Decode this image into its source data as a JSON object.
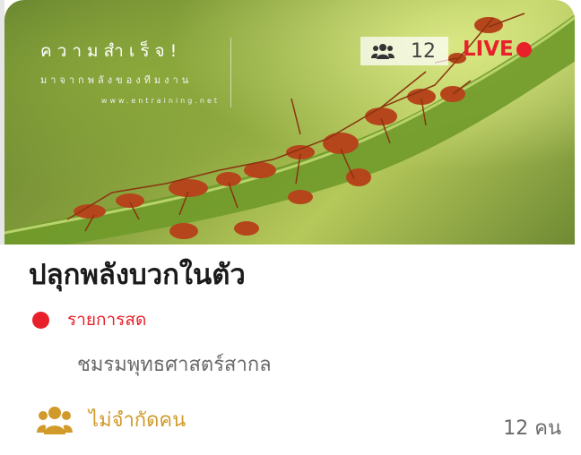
{
  "banner": {
    "brand_title": "ความสำเร็จ!",
    "brand_subtitle": "มาจากพลังของทีมงาน",
    "brand_url": "www.entraining.net",
    "viewer_count": "12",
    "live_label": "LIVE",
    "live_color": "#e8202a",
    "viewer_icon": "group-users-icon"
  },
  "event": {
    "title": "ปลุกพลังบวกในตัว",
    "status_label": "รายการสด",
    "status_color": "#e8202a",
    "organizer": "ชมรมพุทธศาสตร์สากล",
    "capacity_label": "ไม่จำกัดคน",
    "capacity_icon": "group-users-icon",
    "capacity_color": "#d19a2a",
    "attendee_count": "12 คน"
  }
}
